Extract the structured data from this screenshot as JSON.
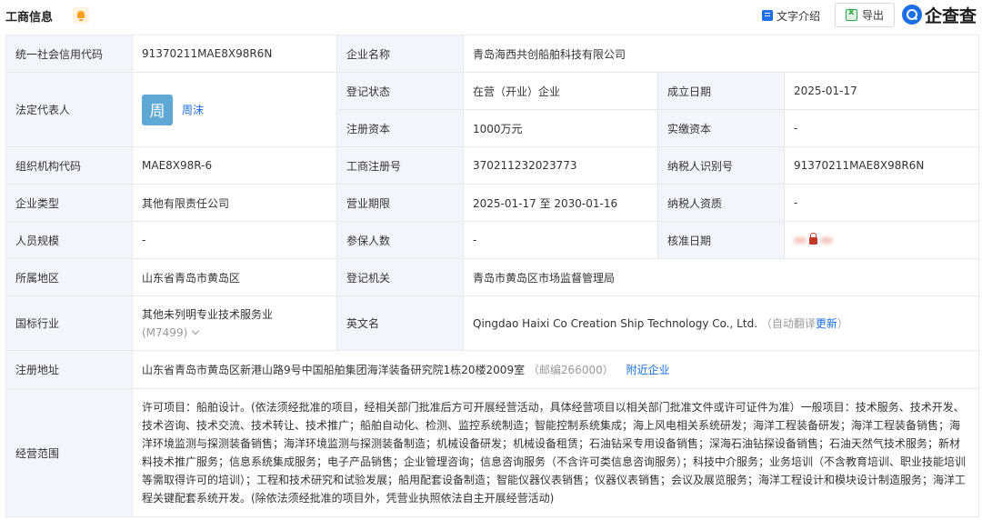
{
  "header": {
    "title": "工商信息",
    "text_intro": "文字介绍",
    "export": "导出",
    "logo": "企查查"
  },
  "labels": {
    "credit_code": "统一社会信用代码",
    "company_name": "企业名称",
    "legal_rep": "法定代表人",
    "reg_status": "登记状态",
    "established": "成立日期",
    "reg_capital": "注册资本",
    "paid_capital": "实缴资本",
    "org_code": "组织机构代码",
    "reg_no": "工商注册号",
    "taxpayer_id": "纳税人识别号",
    "company_type": "企业类型",
    "term": "营业期限",
    "taxpayer_qual": "纳税人资质",
    "staff_size": "人员规模",
    "insured": "参保人数",
    "approval_date": "核准日期",
    "region": "所属地区",
    "reg_authority": "登记机关",
    "industry": "国标行业",
    "english_name": "英文名",
    "address": "注册地址",
    "scope": "经营范围"
  },
  "values": {
    "credit_code": "91370211MAE8X98R6N",
    "company_name": "青岛海西共创船舶科技有限公司",
    "legal_rep_avatar": "周",
    "legal_rep": "周沫",
    "reg_status": "在营（开业）企业",
    "established": "2025-01-17",
    "reg_capital": "1000万元",
    "paid_capital": "-",
    "org_code": "MAE8X98R-6",
    "reg_no": "370211232023773",
    "taxpayer_id": "91370211MAE8X98R6N",
    "company_type": "其他有限责任公司",
    "term": "2025-01-17 至 2030-01-16",
    "taxpayer_qual": "-",
    "staff_size": "-",
    "insured": "-",
    "region": "山东省青岛市黄岛区",
    "reg_authority": "青岛市黄岛区市场监督管理局",
    "industry": "其他未列明专业技术服务业",
    "industry_code": "(M7499)",
    "english_name": "Qingdao Haixi Co Creation Ship Technology Co., Ltd.",
    "auto_translate": "（自动翻译",
    "update": "更新",
    "close_paren": "）",
    "address": "山东省青岛市黄岛区新港山路9号中国船舶集团海洋装备研究院1栋20楼2009室",
    "postcode": "（邮编266000）",
    "nearby": "附近企业",
    "scope": "许可项目：船舶设计。(依法须经批准的项目，经相关部门批准后方可开展经营活动，具体经营项目以相关部门批准文件或许可证件为准）一般项目：技术服务、技术开发、技术咨询、技术交流、技术转让、技术推广；船舶自动化、检测、监控系统制造；智能控制系统集成；海上风电相关系统研发；海洋工程装备研发；海洋工程装备销售；海洋环境监测与探测装备销售；海洋环境监测与探测装备制造；机械设备研发；机械设备租赁；石油钻采专用设备销售；深海石油钻探设备销售；石油天然气技术服务；新材料技术推广服务；信息系统集成服务；电子产品销售；企业管理咨询；信息咨询服务（不含许可类信息咨询服务）；科技中介服务；业务培训（不含教育培训、职业技能培训等需取得许可的培训）；工程和技术研究和试验发展；船用配套设备制造；智能仪器仪表销售；仪器仪表销售；会议及展览服务；海洋工程设计和模块设计制造服务；海洋工程关键配套系统开发。(除依法须经批准的项目外，凭营业执照依法自主开展经营活动)"
  },
  "icons": {
    "bell": "bell-icon",
    "text_intro": "document-icon",
    "export": "excel-icon",
    "logo": "qcc-logo-icon",
    "lock": "lock-icon",
    "chevron": "chevron-down-icon"
  },
  "colors": {
    "accent": "#1a6fe8",
    "label_bg": "#f2f6fc",
    "border": "#e7e9ee",
    "bell": "#ff9f1a",
    "avatar": "#5fa8d6"
  }
}
